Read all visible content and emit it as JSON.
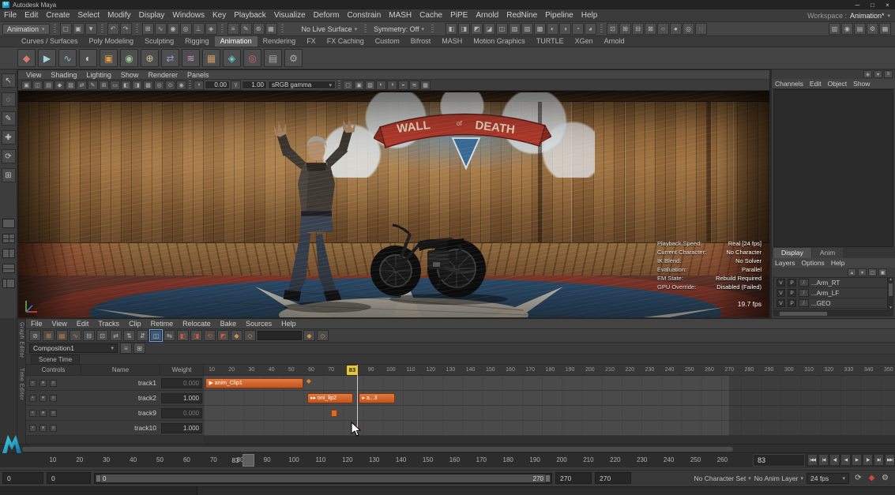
{
  "window": {
    "title": "Autodesk Maya",
    "badge": "M",
    "minimize": "─",
    "maximize": "□",
    "close": "×"
  },
  "menubar": {
    "items": [
      "File",
      "Edit",
      "Create",
      "Select",
      "Modify",
      "Display",
      "Windows",
      "Key",
      "Playback",
      "Visualize",
      "Deform",
      "Constrain",
      "MASH",
      "Cache",
      "PiPE",
      "Arnold",
      "RedNine",
      "Pipeline",
      "Help"
    ],
    "workspace_label": "Workspace :",
    "workspace_value": "Animation*"
  },
  "statusline": {
    "menu_set": "Animation",
    "live_surface": "No Live Surface",
    "symmetry": "Symmetry: Off",
    "g_scene": [
      {
        "n": "new-scene-icon",
        "g": "▢"
      },
      {
        "n": "open-scene-icon",
        "g": "▣"
      },
      {
        "n": "save-scene-icon",
        "g": "▼"
      }
    ],
    "g_undo": [
      {
        "n": "undo-icon",
        "g": "↶"
      },
      {
        "n": "redo-icon",
        "g": "↷"
      }
    ],
    "g_snap": [
      {
        "n": "snap-to-grid-icon",
        "g": "⊞"
      },
      {
        "n": "snap-to-curve-icon",
        "g": "∿"
      },
      {
        "n": "snap-to-point-icon",
        "g": "◉"
      },
      {
        "n": "snap-to-projected-center-icon",
        "g": "◎"
      },
      {
        "n": "snap-to-view-plane-icon",
        "g": "⊥"
      },
      {
        "n": "make-live-icon",
        "g": "◈"
      }
    ],
    "g_hist": [
      {
        "n": "construction-history-icon",
        "g": "≡"
      },
      {
        "n": "modeling-pencil-icon",
        "g": "✎"
      },
      {
        "n": "selection-mask-icon",
        "g": "⊚"
      },
      {
        "n": "highlight-selection-icon",
        "g": "▦"
      }
    ],
    "g_render": [
      {
        "n": "render-view-icon",
        "g": "◧"
      },
      {
        "n": "ipr-render-icon",
        "g": "◨"
      },
      {
        "n": "render-settings-icon",
        "g": "◩"
      },
      {
        "n": "hypershade-icon",
        "g": "◪"
      },
      {
        "n": "light-editor-icon",
        "g": "◫"
      },
      {
        "n": "paint-effects-icon",
        "g": "▧"
      },
      {
        "n": "uv-editor-icon",
        "g": "▨"
      },
      {
        "n": "node-editor-icon",
        "g": "▩"
      },
      {
        "n": "outliner-icon",
        "g": "◐"
      },
      {
        "n": "graph-editor-icon",
        "g": "◑"
      },
      {
        "n": "dope-sheet-icon",
        "g": "◔"
      },
      {
        "n": "time-editor-icon",
        "g": "◕"
      }
    ],
    "g_display": [
      {
        "n": "grid-toggle-icon",
        "g": "⊡"
      },
      {
        "n": "wireframe-toggle-icon",
        "g": "⊞"
      },
      {
        "n": "shaded-toggle-icon",
        "g": "⊟"
      },
      {
        "n": "textured-toggle-icon",
        "g": "⊠"
      },
      {
        "n": "light-toggle-icon",
        "g": "○"
      },
      {
        "n": "shadow-toggle-icon",
        "g": "●"
      },
      {
        "n": "xray-toggle-icon",
        "g": "◎"
      },
      {
        "n": "camera-toggle-icon",
        "g": "◌"
      }
    ],
    "g_sidebar": [
      {
        "n": "modeling-toolkit-icon",
        "g": "▥"
      },
      {
        "n": "humanik-icon",
        "g": "◉"
      },
      {
        "n": "attribute-editor-icon",
        "g": "▤"
      },
      {
        "n": "tool-settings-icon",
        "g": "⚙"
      },
      {
        "n": "channel-box-icon",
        "g": "▦"
      }
    ]
  },
  "shelf": {
    "tabs": [
      {
        "label": "Curves / Surfaces"
      },
      {
        "label": "Poly Modeling"
      },
      {
        "label": "Sculpting"
      },
      {
        "label": "Rigging"
      },
      {
        "label": "Animation",
        "active": true
      },
      {
        "label": "Rendering"
      },
      {
        "label": "FX"
      },
      {
        "label": "FX Caching"
      },
      {
        "label": "Custom"
      },
      {
        "label": "Bifrost"
      },
      {
        "label": "MASH"
      },
      {
        "label": "Motion Graphics"
      },
      {
        "label": "TURTLE"
      },
      {
        "label": "XGen"
      },
      {
        "label": "Arnold"
      }
    ],
    "side": {
      "menu_glyph": "▾",
      "tab_glyph": "≡"
    },
    "icons": [
      {
        "n": "shelf-set-key-icon",
        "g": "◆",
        "c": "#d87a6a"
      },
      {
        "n": "shelf-playblast-icon",
        "g": "▶",
        "c": "#9dd4dd"
      },
      {
        "n": "shelf-motion-trail-icon",
        "g": "∿",
        "c": "#8cc4cc"
      },
      {
        "n": "shelf-ghost-icon",
        "g": "◐",
        "c": "#cccccc"
      },
      {
        "n": "shelf-create-clip-icon",
        "g": "▣",
        "c": "#dd9944"
      },
      {
        "n": "shelf-pose-icon",
        "g": "◉",
        "c": "#99cc99"
      },
      {
        "n": "shelf-constraint-icon",
        "g": "⊕",
        "c": "#cccc99"
      },
      {
        "n": "shelf-ik-handle-icon",
        "g": "⇄",
        "c": "#9999cc"
      },
      {
        "n": "shelf-anim-curves-icon",
        "g": "≋",
        "c": "#cc99cc"
      },
      {
        "n": "shelf-bake-icon",
        "g": "▦",
        "c": "#cc9966"
      },
      {
        "n": "shelf-retarget-icon",
        "g": "◈",
        "c": "#66cccc"
      },
      {
        "n": "shelf-hik-icon",
        "g": "◎",
        "c": "#cc6666"
      },
      {
        "n": "shelf-editor-icon",
        "g": "▤",
        "c": "#aaaaaa"
      },
      {
        "n": "shelf-options-icon",
        "g": "⚙",
        "c": "#aaaaaa"
      }
    ]
  },
  "toolbox": {
    "tools": [
      {
        "n": "select-tool-icon",
        "g": "↖"
      },
      {
        "n": "lasso-tool-icon",
        "g": "◌"
      },
      {
        "n": "paint-select-tool-icon",
        "g": "✎"
      },
      {
        "n": "move-tool-icon",
        "g": "✚"
      },
      {
        "n": "rotate-tool-icon",
        "g": "⟳"
      },
      {
        "n": "scale-tool-icon",
        "g": "⊞"
      }
    ]
  },
  "viewport": {
    "menus": [
      "View",
      "Shading",
      "Lighting",
      "Show",
      "Renderer",
      "Panels"
    ],
    "icons_left": [
      {
        "n": "select-camera-icon",
        "g": "▣"
      },
      {
        "n": "lock-camera-icon",
        "g": "◫"
      },
      {
        "n": "camera-attributes-icon",
        "g": "▤"
      },
      {
        "n": "bookmark-view-icon",
        "g": "◆"
      },
      {
        "n": "image-plane-icon",
        "g": "▧"
      },
      {
        "n": "two-d-pan-zoom-icon",
        "g": "⇄"
      },
      {
        "n": "grease-pencil-icon",
        "g": "✎"
      },
      {
        "n": "grid-display-icon",
        "g": "⊞"
      },
      {
        "n": "film-gate-icon",
        "g": "▭"
      },
      {
        "n": "resolution-gate-icon",
        "g": "◧"
      },
      {
        "n": "gate-mask-icon",
        "g": "◨"
      },
      {
        "n": "field-chart-icon",
        "g": "▩"
      },
      {
        "n": "safe-action-icon",
        "g": "◎"
      },
      {
        "n": "safe-title-icon",
        "g": "⊙"
      },
      {
        "n": "isolate-select-icon",
        "g": "◉"
      }
    ],
    "exposure_icon": "◑",
    "exposure": "0.00",
    "gamma_icon": "γ",
    "gamma": "1.00",
    "view_transform": "sRGB gamma",
    "icons_right": [
      {
        "n": "wireframe-mode-icon",
        "g": "▢"
      },
      {
        "n": "shaded-mode-icon",
        "g": "▣"
      },
      {
        "n": "textured-mode-icon",
        "g": "▨"
      },
      {
        "n": "lighting-icon",
        "g": "◐"
      },
      {
        "n": "shadows-icon",
        "g": "◑"
      },
      {
        "n": "ssao-icon",
        "g": "◒"
      },
      {
        "n": "motion-blur-icon",
        "g": "≋"
      },
      {
        "n": "anti-aliasing-icon",
        "g": "▩"
      }
    ],
    "hud": {
      "rows": [
        {
          "label": "Playback Speed:",
          "value": "Real [24 fps]"
        },
        {
          "label": "Current Character:",
          "value": "No Character"
        },
        {
          "label": "IK Blend:",
          "value": "No Solver"
        },
        {
          "label": "Evaluation:",
          "value": "Parallel"
        },
        {
          "label": "EM State:",
          "value": "Rebuild Required"
        },
        {
          "label": "GPU Override:",
          "value": "Disabled (Failed)"
        }
      ],
      "fps": "19.7 fps"
    },
    "banner": {
      "wall": "WALL",
      "of": "of",
      "death": "DEATH"
    }
  },
  "right_panel": {
    "top_icons": [
      {
        "n": "pin-panel-icon",
        "g": "◈"
      },
      {
        "n": "panel-bookmark-icon",
        "g": "▾"
      },
      {
        "n": "panel-menu-icon",
        "g": "≡"
      }
    ],
    "channel_menus": [
      "Channels",
      "Edit",
      "Object",
      "Show"
    ],
    "tabs": [
      {
        "label": "Display",
        "active": true
      },
      {
        "label": "Anim"
      }
    ],
    "layer_menus": [
      "Layers",
      "Options",
      "Help"
    ],
    "layer_icons": [
      {
        "n": "move-layer-up-icon",
        "g": "▴"
      },
      {
        "n": "move-layer-down-icon",
        "g": "▾"
      },
      {
        "n": "empty-layer-icon",
        "g": "▢"
      },
      {
        "n": "new-layer-icon",
        "g": "▣"
      }
    ],
    "layers": [
      {
        "v": "V",
        "p": "P",
        "t": "/",
        "name": "...Arm_RT"
      },
      {
        "v": "V",
        "p": "P",
        "t": "/",
        "name": "...Arm_LF"
      },
      {
        "v": "V",
        "p": "P",
        "t": "/",
        "name": "...GEO"
      }
    ]
  },
  "time_editor": {
    "side_tabs": [
      "Graph Editor",
      "Time Editor"
    ],
    "menus": [
      "File",
      "View",
      "Edit",
      "Tracks",
      "Clip",
      "Retime",
      "Relocate",
      "Bake",
      "Sources",
      "Help"
    ],
    "toolbar_icons": [
      {
        "n": "mute-track-icon",
        "g": "⊘"
      },
      {
        "n": "add-track-icon",
        "g": "⊞",
        "c": "#d3813f"
      },
      {
        "n": "add-group-track-icon",
        "g": "▤",
        "c": "#d3813f"
      },
      {
        "n": "add-audio-track-icon",
        "g": "∿",
        "c": "#d3813f"
      },
      {
        "n": "delete-track-icon",
        "g": "⊟"
      },
      {
        "n": "frame-all-icon",
        "g": "⊡"
      },
      {
        "n": "zoom-to-fit-icon",
        "g": "⇄"
      },
      {
        "n": "navigate-up-icon",
        "g": "⇅"
      },
      {
        "n": "step-into-icon",
        "g": "⇵"
      },
      {
        "n": "snap-to-clip-icon",
        "g": "◫",
        "active": true
      },
      {
        "n": "ripple-edit-icon",
        "g": "⇆"
      },
      {
        "n": "razor-clip-icon",
        "g": "◧",
        "c": "#cf5b33"
      },
      {
        "n": "trim-clip-icon",
        "g": "◨",
        "c": "#cf5b33"
      },
      {
        "n": "loop-clip-icon",
        "g": "⟲",
        "c": "#cf5b33"
      },
      {
        "n": "hold-clip-icon",
        "g": "◩",
        "c": "#cf5b33"
      },
      {
        "n": "set-key-icon",
        "g": "◆",
        "c": "#d89040"
      },
      {
        "n": "set-zero-key-icon",
        "g": "◇",
        "c": "#d89040"
      }
    ],
    "search_value": "",
    "composition": "Composition1",
    "comp_icons": [
      {
        "n": "composition-options-icon",
        "g": "≡"
      },
      {
        "n": "add-composition-icon",
        "g": "⊞"
      }
    ],
    "scene_time_label": "Scene Time",
    "columns": [
      "Controls",
      "Name",
      "Weight"
    ],
    "tracks": [
      {
        "name": "track1",
        "weight": "0.000"
      },
      {
        "name": "track2",
        "weight": "1.000"
      },
      {
        "name": "track9",
        "weight": "0.000"
      },
      {
        "name": "track10",
        "weight": "1.000"
      }
    ],
    "track_icons": [
      {
        "n": "track-mute-icon",
        "g": "▪"
      },
      {
        "n": "track-solo-icon",
        "g": "●"
      },
      {
        "n": "track-lock-icon",
        "g": "≡"
      }
    ],
    "ruler": {
      "min": 10,
      "max": 350,
      "step": 10,
      "playhead": 83,
      "range_end": 270
    },
    "clips": [
      {
        "track": 0,
        "start": 7,
        "end": 56,
        "label": "▶  anim_Clip1",
        "kind": "clip"
      },
      {
        "track": 0,
        "start": 57.5,
        "end": 59,
        "label": "◆",
        "kind": "marker"
      },
      {
        "track": 1,
        "start": 58,
        "end": 81,
        "label": "▸▸ oni_lip2",
        "kind": "clip"
      },
      {
        "track": 1,
        "start": 84,
        "end": 102,
        "label": "▸ a...3",
        "kind": "clip"
      },
      {
        "track": 2,
        "start": 70,
        "end": 73,
        "label": "",
        "kind": "mini"
      },
      {
        "track": 3,
        "start": 80.5,
        "end": 83.5,
        "label": "",
        "kind": "mini"
      }
    ]
  },
  "timeslider": {
    "ruler": {
      "min": 10,
      "max": 260,
      "step": 10
    },
    "current_frame": 83,
    "current_frame_label": "83",
    "current_time_field": "83",
    "playback": [
      {
        "n": "go-to-start-button",
        "g": "|◀◀"
      },
      {
        "n": "previous-key-button",
        "g": "|◀"
      },
      {
        "n": "step-back-button",
        "g": "◀|"
      },
      {
        "n": "play-backwards-button",
        "g": "◀"
      },
      {
        "n": "play-forwards-button",
        "g": "▶"
      },
      {
        "n": "step-forward-button",
        "g": "|▶"
      },
      {
        "n": "next-key-button",
        "g": "▶|"
      },
      {
        "n": "go-to-end-button",
        "g": "▶▶|"
      }
    ]
  },
  "rangeslider": {
    "anim_start": "0",
    "playback_start": "0",
    "slider_start_label": "0",
    "slider_end_label": "270",
    "playback_end": "270",
    "anim_end": "270",
    "character_set": "No Character Set",
    "anim_layer": "No Anim Layer",
    "fps": "24 fps",
    "icons": [
      {
        "n": "playback-loop-icon",
        "g": "⟳"
      },
      {
        "n": "auto-keyframe-icon",
        "g": "◆",
        "c": "#cf4a3a"
      },
      {
        "n": "animation-preferences-icon",
        "g": "⚙"
      }
    ]
  }
}
